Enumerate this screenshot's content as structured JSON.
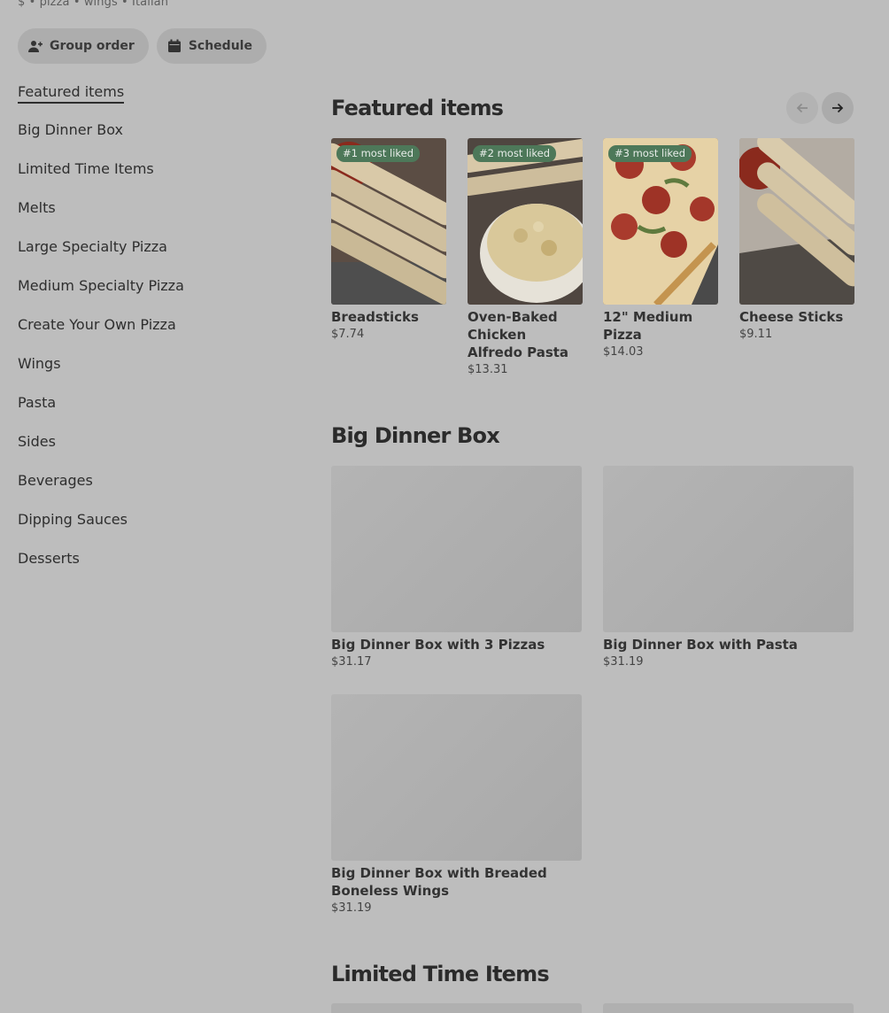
{
  "store": {
    "tags": "$ • pizza • wings • Italian"
  },
  "actions": {
    "group_order": "Group order",
    "schedule": "Schedule"
  },
  "sidebar": {
    "items": [
      {
        "label": "Featured items"
      },
      {
        "label": "Big Dinner Box"
      },
      {
        "label": "Limited Time Items"
      },
      {
        "label": "Melts"
      },
      {
        "label": "Large Specialty Pizza"
      },
      {
        "label": "Medium Specialty Pizza"
      },
      {
        "label": "Create Your Own Pizza"
      },
      {
        "label": "Wings"
      },
      {
        "label": "Pasta"
      },
      {
        "label": "Sides"
      },
      {
        "label": "Beverages"
      },
      {
        "label": "Dipping Sauces"
      },
      {
        "label": "Desserts"
      }
    ]
  },
  "featured": {
    "title": "Featured items",
    "items": [
      {
        "badge": "#1 most liked",
        "name": "Breadsticks",
        "price": "$7.74"
      },
      {
        "badge": "#2 most liked",
        "name": "Oven-Baked Chicken Alfredo Pasta",
        "price": "$13.31"
      },
      {
        "badge": "#3 most liked",
        "name": "12\" Medium Pizza",
        "price": "$14.03"
      },
      {
        "badge": "",
        "name": "Cheese Sticks",
        "price": "$9.11"
      }
    ]
  },
  "big_dinner_box": {
    "title": "Big Dinner Box",
    "items": [
      {
        "name": "Big Dinner Box with 3 Pizzas",
        "price": "$31.17"
      },
      {
        "name": "Big Dinner Box with Pasta",
        "price": "$31.19"
      },
      {
        "name": "Big Dinner Box with Breaded Boneless Wings",
        "price": "$31.19"
      }
    ]
  },
  "limited_time": {
    "title": "Limited Time Items"
  },
  "colors": {
    "background": "#bdbdbd",
    "badge": "#4d7859"
  }
}
